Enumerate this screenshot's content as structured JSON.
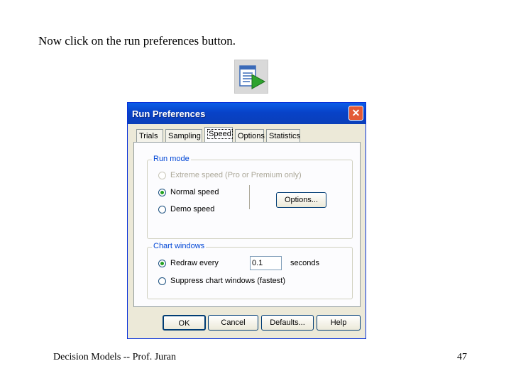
{
  "slide": {
    "instruction": "Now click on the run preferences button.",
    "footer_left": "Decision Models -- Prof. Juran",
    "page_number": "47"
  },
  "toolbar_button": {
    "icon": "run-preferences-icon"
  },
  "dialog": {
    "title": "Run Preferences",
    "close_label": "✕",
    "tabs": [
      "Trials",
      "Sampling",
      "Speed",
      "Options",
      "Statistics"
    ],
    "active_tab": "Speed",
    "run_mode": {
      "label": "Run mode",
      "options": [
        {
          "label": "Extreme speed  (Pro or Premium only)",
          "checked": false,
          "disabled": true
        },
        {
          "label": "Normal speed",
          "checked": true,
          "disabled": false
        },
        {
          "label": "Demo speed",
          "checked": false,
          "disabled": false
        }
      ],
      "options_button": "Options..."
    },
    "chart_windows": {
      "label": "Chart windows",
      "redraw_label": "Redraw every",
      "redraw_value": "0.1",
      "redraw_unit": "seconds",
      "suppress_label": "Suppress chart windows (fastest)"
    },
    "buttons": {
      "ok": "OK",
      "cancel": "Cancel",
      "defaults": "Defaults...",
      "help": "Help"
    }
  }
}
